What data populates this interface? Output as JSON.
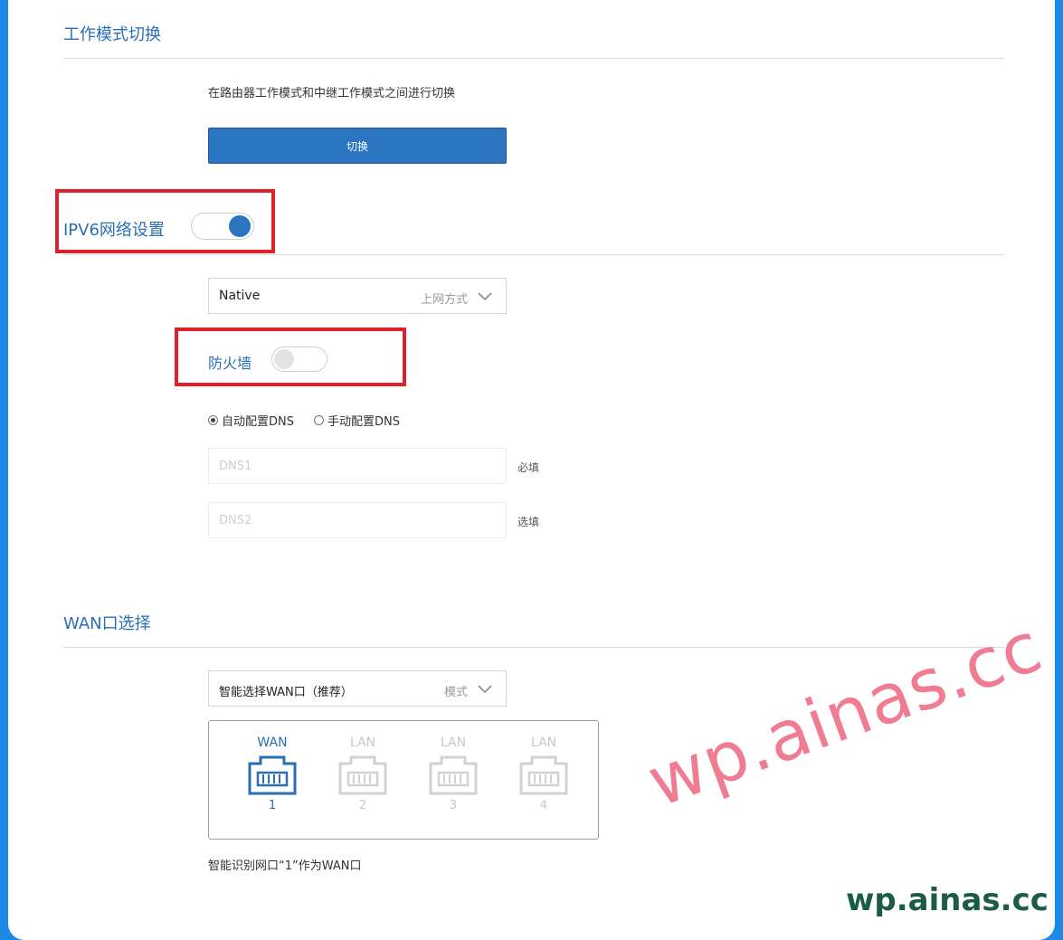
{
  "colors": {
    "accent": "#2a74c0",
    "frame": "#1e88e5",
    "highlight": "#e0202a"
  },
  "work_mode": {
    "title": "工作模式切换",
    "description": "在路由器工作模式和中继工作模式之间进行切换",
    "switch_button": "切换"
  },
  "ipv6": {
    "title": "IPV6网络设置",
    "enabled": true,
    "connection_type": {
      "value": "Native",
      "label": "上网方式"
    },
    "firewall": {
      "label": "防火墙",
      "enabled": false
    },
    "dns_mode": {
      "options": [
        {
          "label": "自动配置DNS",
          "checked": true
        },
        {
          "label": "手动配置DNS",
          "checked": false
        }
      ]
    },
    "dns1": {
      "placeholder": "DNS1",
      "note": "必填"
    },
    "dns2": {
      "placeholder": "DNS2",
      "note": "选填"
    }
  },
  "wan": {
    "title": "WAN口选择",
    "mode": {
      "value": "智能选择WAN口（推荐）",
      "label": "模式"
    },
    "ports": [
      {
        "label": "WAN",
        "number": "1",
        "icon": "ethernet-port-icon",
        "active": true
      },
      {
        "label": "LAN",
        "number": "2",
        "icon": "ethernet-port-icon",
        "active": false
      },
      {
        "label": "LAN",
        "number": "3",
        "icon": "ethernet-port-icon",
        "active": false
      },
      {
        "label": "LAN",
        "number": "4",
        "icon": "ethernet-port-icon",
        "active": false
      }
    ],
    "status_text": "智能识别网口“1”作为WAN口"
  },
  "watermark": {
    "large": "wp.ainas.cc",
    "small": "wp.ainas.cc"
  }
}
